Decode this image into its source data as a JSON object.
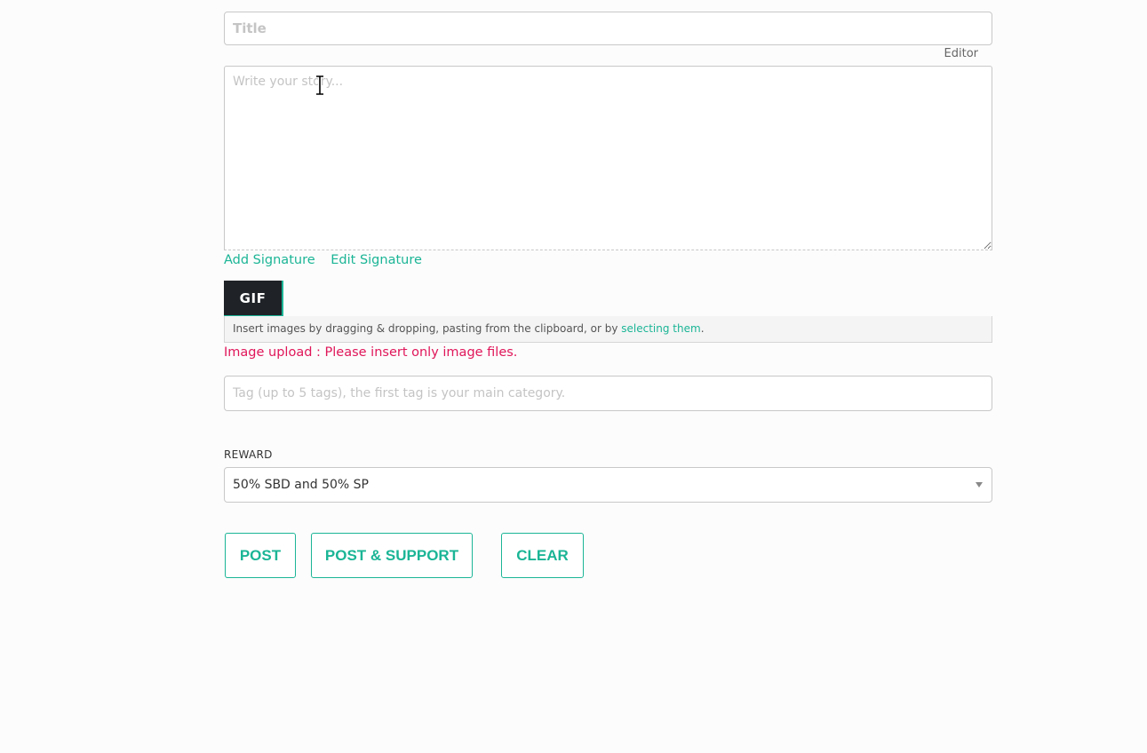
{
  "title_field": {
    "placeholder": "Title",
    "value": ""
  },
  "editor_toggle": {
    "label": "Editor"
  },
  "story_field": {
    "placeholder": "Write your story...",
    "value": ""
  },
  "signature": {
    "add_label": "Add Signature",
    "edit_label": "Edit Signature"
  },
  "gif_button": {
    "label": "GIF"
  },
  "image_drop": {
    "text_before": "Insert images by dragging & dropping, pasting from the clipboard, or by ",
    "link_label": "selecting them",
    "text_after": "."
  },
  "upload_error": {
    "message": "Image upload : Please insert only image files."
  },
  "tag_field": {
    "placeholder": "Tag (up to 5 tags), the first tag is your main category.",
    "value": ""
  },
  "reward": {
    "label": "REWARD",
    "selected": "50% SBD and 50% SP",
    "caret_icon": "caret-down-icon"
  },
  "actions": {
    "post_label": "POST",
    "post_support_label": "POST & SUPPORT",
    "clear_label": "CLEAR"
  },
  "colors": {
    "accent": "#1bb596",
    "error": "#e0175a",
    "gif_bg": "#1f2328",
    "background": "#fcfcfc"
  }
}
